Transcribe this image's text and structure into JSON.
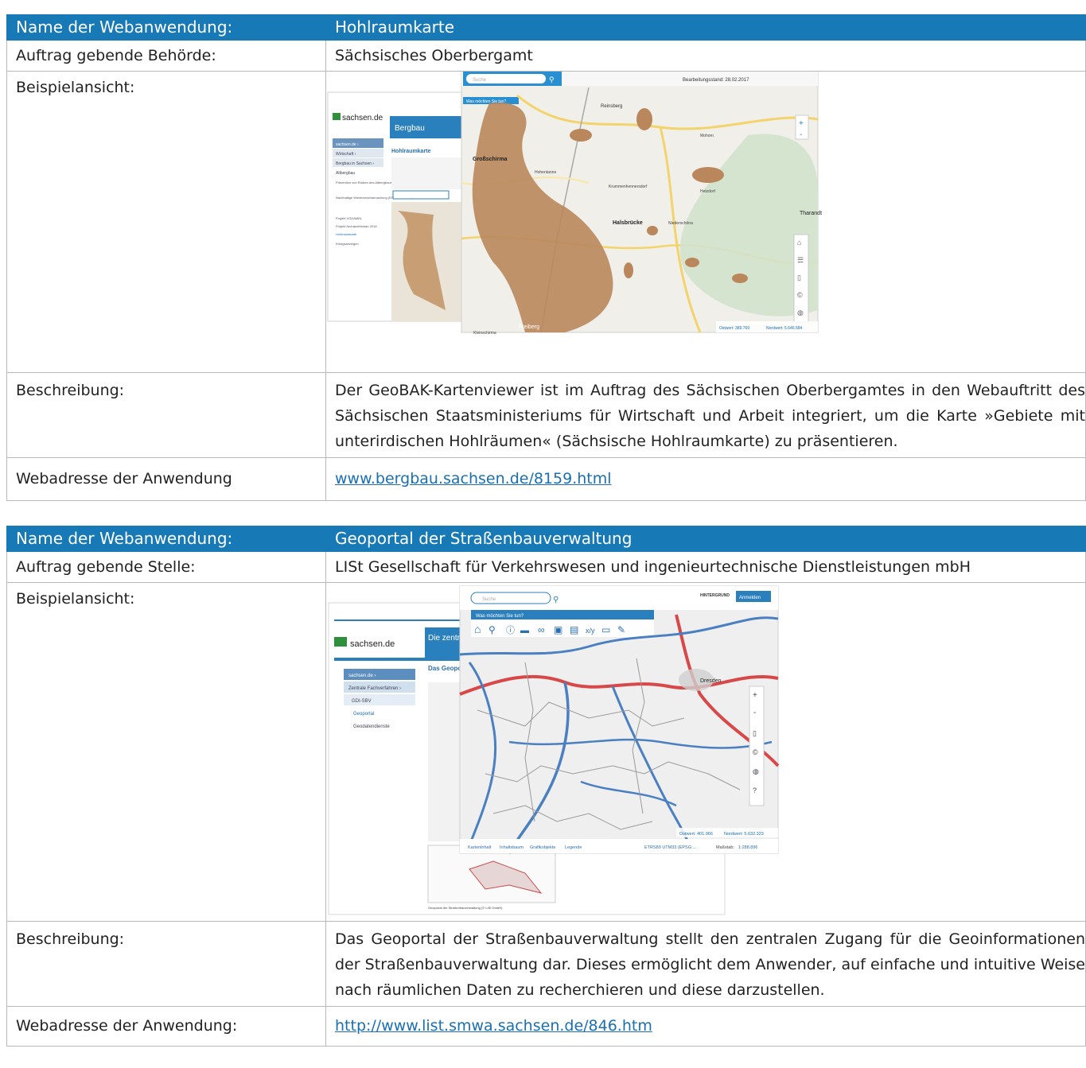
{
  "top_caption": "",
  "apps": [
    {
      "name_label": "Name der Webanwendung:",
      "name": "Hohlraumkarte",
      "authority_label": "Auftrag gebende Behörde:",
      "authority": "Sächsisches Oberbergamt",
      "example_label": "Beispielansicht:",
      "description_label": "Beschreibung:",
      "description": "Der GeoBAK-Kartenviewer ist im Auftrag des Sächsischen Oberbergamtes in den Webauftritt des Sächsischen Staatsministeriums für Wirtschaft und Arbeit integriert, um die Karte »Gebiete mit unterirdischen Hohlräumen« (Sächsische Hohlraumkarte) zu präsentieren.",
      "url_label": "Webadresse der Anwendung",
      "url": "www.bergbau.sachsen.de/8159.html",
      "screenshot": {
        "search_placeholder": "Suche",
        "site_logo": "sachsen.de",
        "site_header": "Bergbau",
        "page_title": "Hohlraumkarte",
        "prompt": "Was möchten Sie tun?",
        "stand": "Bearbeitungsstand: 28.02.2017",
        "ostwert": "Ostwert: 389.769",
        "nordwert": "Nordwert: 5.646.584",
        "places": [
          "Roßwein",
          "Großschirma",
          "Hohentanne",
          "Nossen",
          "Halsbrücke",
          "Tharandt",
          "Freiberg",
          "Reinsberg",
          "Kleinschirma",
          "Niederschöna",
          "Hetzdorf",
          "Krummenhennersdorf",
          "Mohorn"
        ],
        "nav": [
          "sachsen.de ›",
          "Wirtschaft ›",
          "Bergbau in Sachsen ›",
          "Altbergbau",
          "Prävention von Risiken des Altbergbaus (EFRE-Vorhaben)",
          "Nachhaltige Wiedernutzbarmachung (EFRE-Vorhaben)",
          "Projekt VODAMIN",
          "Projekt ArchaeoMontan 2018",
          "Hohlraumkarte",
          "Erfolgsanzeigen"
        ]
      }
    },
    {
      "name_label": "Name der Webanwendung:",
      "name": "Geoportal der Straßenbauverwaltung",
      "authority_label": "Auftrag gebende Stelle:",
      "authority": "LISt Gesellschaft für Verkehrswesen und ingenieurtechnische Dienstleistungen mbH",
      "example_label": "Beispielansicht:",
      "description_label": "Beschreibung:",
      "description": "Das Geoportal der Straßenbauverwaltung stellt den zentralen Zugang für die Geoinformationen der Straßenbauverwaltung dar. Dieses ermöglicht dem Anwender, auf einfache und intuitive Weise nach räumlichen Daten zu recherchieren und diese darzustellen.",
      "url_label": "Webadresse der Anwendung:",
      "url": "http://www.list.smwa.sachsen.de/846.htm",
      "screenshot": {
        "search_placeholder": "Suche",
        "site_logo": "sachsen.de",
        "site_header": "Die zentr Verkehr",
        "page_title": "Das Geopor Visualisier",
        "prompt": "Was möchten Sie tun?",
        "hintergrund": "HINTERGRUND",
        "login": "Anmelden",
        "ostwert": "Ostwert: 401.966",
        "nordwert": "Nordwert: 5.632.323",
        "crs": "ETRS89 UTM33 (EPSG:...",
        "scale_label": "Maßstab:",
        "scale": "1:288.896",
        "city": "Dresden",
        "bottom_tabs": [
          "Kartenlnhalt",
          "Inhaltsbaum",
          "Grafikobjekte",
          "Legende"
        ],
        "nav": [
          "sachsen.de ›",
          "Zentrale Fachverfahren ›",
          "GDI-SBV",
          "Geoportal",
          "Geodatendienste"
        ],
        "caption": "Geoportal der Straßenbauverwaltung (© LISt GmbH)"
      }
    }
  ]
}
